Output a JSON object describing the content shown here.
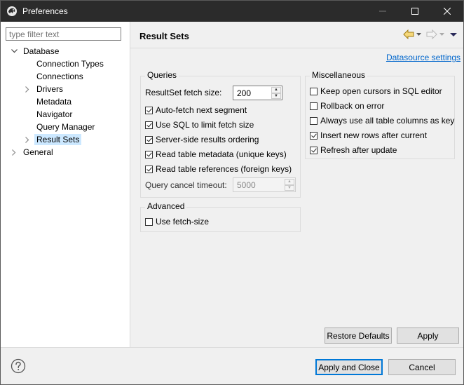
{
  "window": {
    "title": "Preferences"
  },
  "sidebar": {
    "filter_placeholder": "type filter text",
    "items": [
      {
        "label": "Database"
      },
      {
        "label": "Connection Types"
      },
      {
        "label": "Connections"
      },
      {
        "label": "Drivers"
      },
      {
        "label": "Metadata"
      },
      {
        "label": "Navigator"
      },
      {
        "label": "Query Manager"
      },
      {
        "label": "Result Sets"
      },
      {
        "label": "General"
      }
    ]
  },
  "page": {
    "title": "Result Sets",
    "datasource_link": "Datasource settings"
  },
  "queries": {
    "legend": "Queries",
    "fetch_size_label": "ResultSet fetch size:",
    "fetch_size_value": "200",
    "options": [
      {
        "label": "Auto-fetch next segment",
        "checked": true
      },
      {
        "label": "Use SQL to limit fetch size",
        "checked": true
      },
      {
        "label": "Server-side results ordering",
        "checked": true
      },
      {
        "label": "Read table metadata (unique keys)",
        "checked": true
      },
      {
        "label": "Read table references (foreign keys)",
        "checked": true
      }
    ],
    "cancel_timeout_label": "Query cancel timeout:",
    "cancel_timeout_value": "5000"
  },
  "advanced": {
    "legend": "Advanced",
    "use_fetch_size_label": "Use fetch-size",
    "use_fetch_size_checked": false
  },
  "misc": {
    "legend": "Miscellaneous",
    "options": [
      {
        "label": "Keep open cursors in SQL editor",
        "checked": false
      },
      {
        "label": "Rollback on error",
        "checked": false
      },
      {
        "label": "Always use all table columns as key",
        "checked": false
      },
      {
        "label": "Insert new rows after current",
        "checked": true
      },
      {
        "label": "Refresh after update",
        "checked": true
      }
    ]
  },
  "buttons": {
    "restore_defaults": "Restore Defaults",
    "apply": "Apply",
    "apply_and_close": "Apply and Close",
    "cancel": "Cancel"
  }
}
